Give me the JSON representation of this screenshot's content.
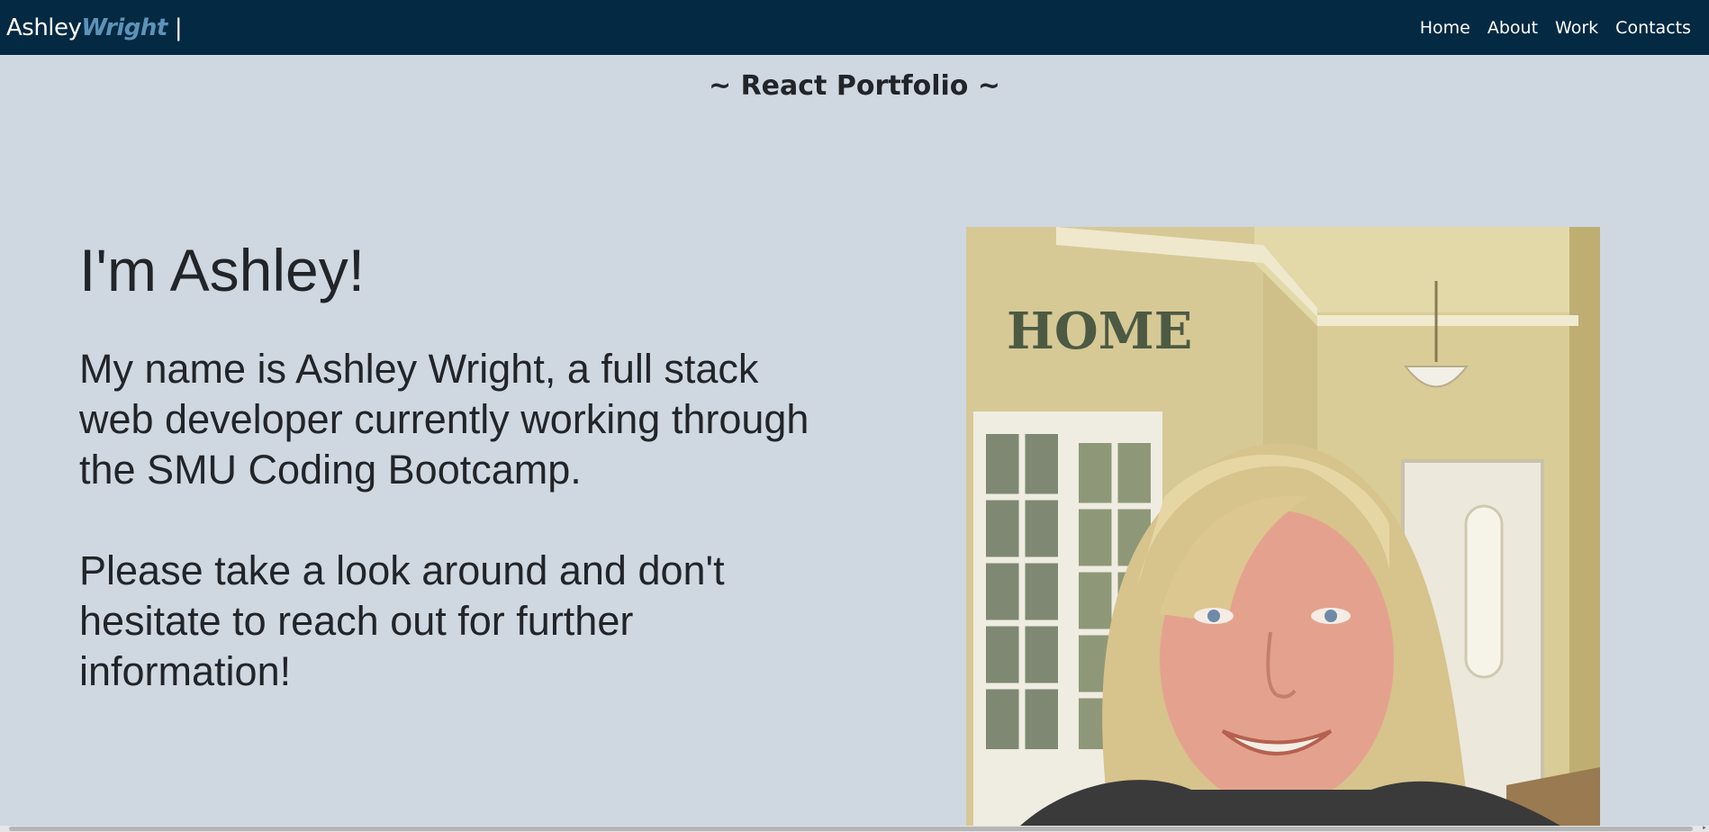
{
  "header": {
    "brand_first": "Ashley",
    "brand_last": "Wright",
    "brand_sep": "|",
    "nav": [
      {
        "label": "Home"
      },
      {
        "label": "About"
      },
      {
        "label": "Work"
      },
      {
        "label": "Contacts"
      }
    ]
  },
  "page": {
    "subtitle": "~ React Portfolio ~"
  },
  "about": {
    "heading": "I'm Ashley!",
    "paragraph1": "My name is Ashley Wright, a full stack web developer currently working through the SMU Coding Bootcamp.",
    "paragraph2": "Please take a look around and don't hesitate to reach out for further information!",
    "photo_sign_text": "HOME"
  },
  "colors": {
    "navbar_bg": "#042942",
    "brand_accent": "#5d93b8",
    "page_bg": "#cfd7e1",
    "text": "#212529"
  }
}
